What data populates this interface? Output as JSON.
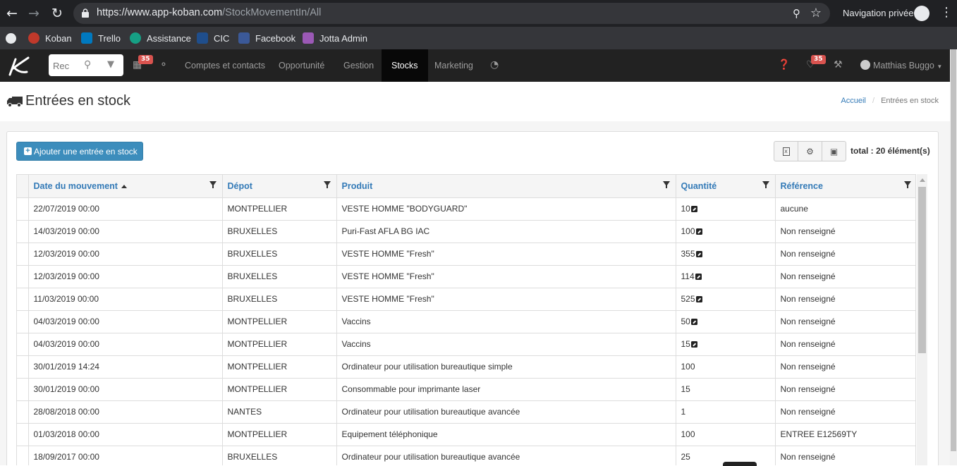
{
  "browser": {
    "url_main": "https://www.app-koban.com",
    "url_path": "/StockMovementIn/All",
    "incognito_label": "Navigation privée",
    "bookmarks": [
      {
        "label": "Koban",
        "color": "#c0392b"
      },
      {
        "label": "Trello",
        "color": "#0079bf"
      },
      {
        "label": "Assistance",
        "color": "#16a085"
      },
      {
        "label": "CIC",
        "color": "#1f4e8c"
      },
      {
        "label": "Facebook",
        "color": "#3b5998"
      },
      {
        "label": "Jotta Admin",
        "color": "#9b59b6"
      }
    ]
  },
  "appnav": {
    "search_placeholder": "Rec",
    "calendar_badge": "35",
    "links": [
      "Comptes et contacts",
      "Opportunité",
      "Gestion",
      "Stocks",
      "Marketing"
    ],
    "active_link": "Stocks",
    "notif_badge": "35",
    "user_name": "Matthias Buggo"
  },
  "page": {
    "title": "Entrées en stock",
    "breadcrumb_home": "Accueil",
    "breadcrumb_current": "Entrées en stock",
    "add_button": "Ajouter une entrée en stock",
    "total_label": "total : 20 élément(s)"
  },
  "table": {
    "columns": [
      "Date du mouvement",
      "Dépot",
      "Produit",
      "Quantité",
      "Référence"
    ],
    "rows": [
      {
        "date": "22/07/2019 00:00",
        "depot": "MONTPELLIER",
        "produit": "VESTE HOMME \"BODYGUARD\"",
        "quantite": "10",
        "link": true,
        "reference": "aucune"
      },
      {
        "date": "14/03/2019 00:00",
        "depot": "BRUXELLES",
        "produit": "Puri-Fast AFLA BG IAC",
        "quantite": "100",
        "link": true,
        "reference": "Non renseigné"
      },
      {
        "date": "12/03/2019 00:00",
        "depot": "BRUXELLES",
        "produit": "VESTE HOMME \"Fresh\"",
        "quantite": "355",
        "link": true,
        "reference": "Non renseigné"
      },
      {
        "date": "12/03/2019 00:00",
        "depot": "BRUXELLES",
        "produit": "VESTE HOMME \"Fresh\"",
        "quantite": "114",
        "link": true,
        "reference": "Non renseigné"
      },
      {
        "date": "11/03/2019 00:00",
        "depot": "BRUXELLES",
        "produit": "VESTE HOMME \"Fresh\"",
        "quantite": "525",
        "link": true,
        "reference": "Non renseigné"
      },
      {
        "date": "04/03/2019 00:00",
        "depot": "MONTPELLIER",
        "produit": "Vaccins",
        "quantite": "50",
        "link": true,
        "reference": "Non renseigné"
      },
      {
        "date": "04/03/2019 00:00",
        "depot": "MONTPELLIER",
        "produit": "Vaccins",
        "quantite": "15",
        "link": true,
        "reference": "Non renseigné"
      },
      {
        "date": "30/01/2019 14:24",
        "depot": "MONTPELLIER",
        "produit": "Ordinateur pour utilisation bureautique simple",
        "quantite": "100",
        "link": false,
        "reference": "Non renseigné"
      },
      {
        "date": "30/01/2019 00:00",
        "depot": "MONTPELLIER",
        "produit": "Consommable pour imprimante laser",
        "quantite": "15",
        "link": false,
        "reference": "Non renseigné"
      },
      {
        "date": "28/08/2018 00:00",
        "depot": "NANTES",
        "produit": "Ordinateur pour utilisation bureautique avancée",
        "quantite": "1",
        "link": false,
        "reference": "Non renseigné"
      },
      {
        "date": "01/03/2018 00:00",
        "depot": "MONTPELLIER",
        "produit": "Equipement téléphonique",
        "quantite": "100",
        "link": false,
        "reference": "ENTREE E12569TY"
      },
      {
        "date": "18/09/2017 00:00",
        "depot": "BRUXELLES",
        "produit": "Ordinateur pour utilisation bureautique avancée",
        "quantite": "25",
        "link": false,
        "reference": "Non renseigné"
      }
    ]
  }
}
